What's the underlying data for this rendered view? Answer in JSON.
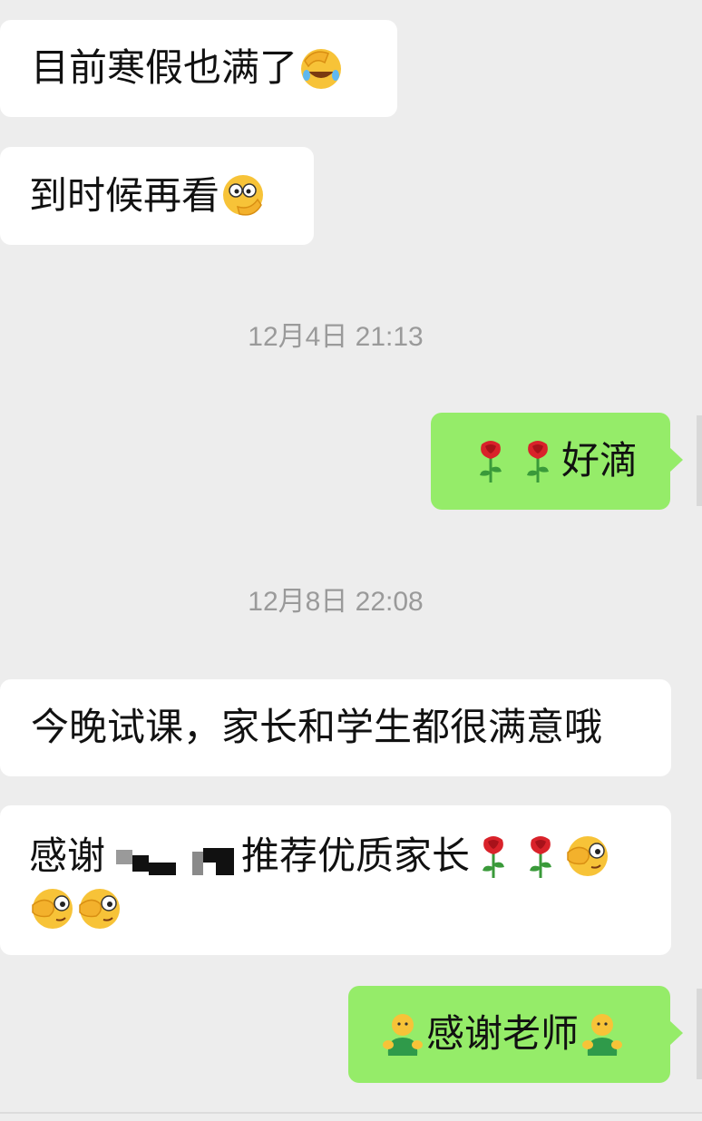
{
  "messages": [
    {
      "type": "in",
      "text": "目前寒假也满了",
      "emoji_after": "face-palm-laughing-icon"
    },
    {
      "type": "in",
      "text": "到时候再看",
      "emoji_after": "thinking-face-icon"
    },
    {
      "type": "time",
      "text": "12月4日 21:13"
    },
    {
      "type": "out",
      "text": "好滴",
      "emoji_before": [
        "rose-icon",
        "rose-icon"
      ]
    },
    {
      "type": "time",
      "text": "12月8日 22:08"
    },
    {
      "type": "in",
      "text": "今晚试课，家长和学生都很满意哦"
    },
    {
      "type": "in",
      "text_prefix": "感谢",
      "redacted": true,
      "text_suffix": "推荐优质家长",
      "emoji_after": [
        "rose-icon",
        "rose-icon",
        "peek-face-icon",
        "peek-face-icon",
        "peek-face-icon"
      ]
    },
    {
      "type": "out",
      "text": "感谢老师",
      "emoji_before": "green-person-icon",
      "emoji_after": "green-person-icon"
    }
  ],
  "colors": {
    "background": "#ededed",
    "incoming_bubble": "#ffffff",
    "outgoing_bubble": "#95ec69",
    "timestamp_text": "#9a9a9a",
    "message_text": "#111111"
  }
}
